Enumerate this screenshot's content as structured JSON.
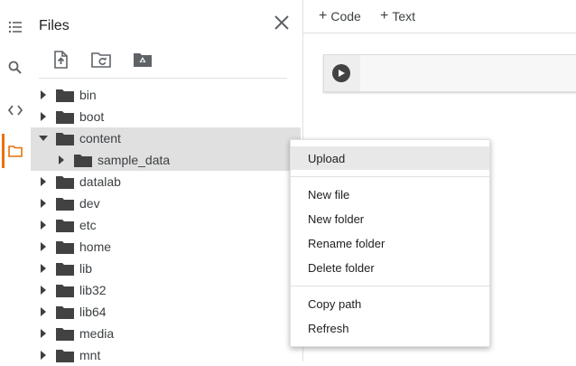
{
  "panel": {
    "title": "Files"
  },
  "topbar": {
    "add_code": "Code",
    "add_text": "Text"
  },
  "tree": {
    "items": [
      {
        "label": "bin"
      },
      {
        "label": "boot"
      },
      {
        "label": "content"
      },
      {
        "label": "sample_data"
      },
      {
        "label": "datalab"
      },
      {
        "label": "dev"
      },
      {
        "label": "etc"
      },
      {
        "label": "home"
      },
      {
        "label": "lib"
      },
      {
        "label": "lib32"
      },
      {
        "label": "lib64"
      },
      {
        "label": "media"
      },
      {
        "label": "mnt"
      }
    ]
  },
  "context_menu": {
    "items": [
      {
        "label": "Upload"
      },
      {
        "label": "New file"
      },
      {
        "label": "New folder"
      },
      {
        "label": "Rename folder"
      },
      {
        "label": "Delete folder"
      },
      {
        "label": "Copy path"
      },
      {
        "label": "Refresh"
      }
    ]
  },
  "icons": {
    "rail": [
      "menu-list-icon",
      "search-icon",
      "code-brackets-icon",
      "folder-icon"
    ],
    "toolbar": [
      "upload-file-icon",
      "refresh-folder-icon",
      "google-drive-icon"
    ]
  },
  "colors": {
    "accent": "#e8710a",
    "selected_row": "#e0e0e0",
    "icon_gray": "#5f6368",
    "folder_gray": "#424242"
  }
}
